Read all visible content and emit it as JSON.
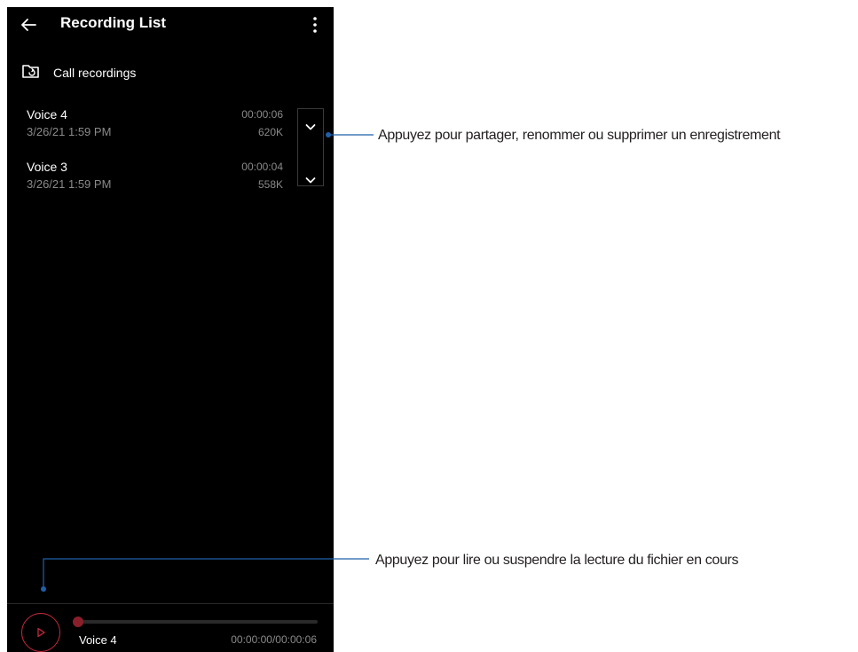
{
  "appbar": {
    "title": "Recording List",
    "back_icon": "arrow-left-icon",
    "more_icon": "more-vertical-icon"
  },
  "folder": {
    "label": "Call recordings",
    "icon": "folder-sync-icon"
  },
  "recordings": [
    {
      "name": "Voice 4",
      "date": "3/26/21 1:59 PM",
      "duration": "00:00:06",
      "size": "620K"
    },
    {
      "name": "Voice 3",
      "date": "3/26/21 1:59 PM",
      "duration": "00:00:04",
      "size": "558K"
    }
  ],
  "player": {
    "current_name": "Voice 4",
    "time": "00:00:00/00:00:06",
    "progress": 0,
    "play_icon": "play-icon"
  },
  "callouts": {
    "options": "Appuyez pour partager, renommer ou supprimer un enregistrement",
    "play": "Appuyez pour lire ou suspendre la lecture du fichier en cours"
  },
  "colors": {
    "background": "#000000",
    "accent": "#c62a3d",
    "seek": "#8a1f2c",
    "secondary_text": "#8a8a8a",
    "callout_line": "#1f5fa8"
  }
}
